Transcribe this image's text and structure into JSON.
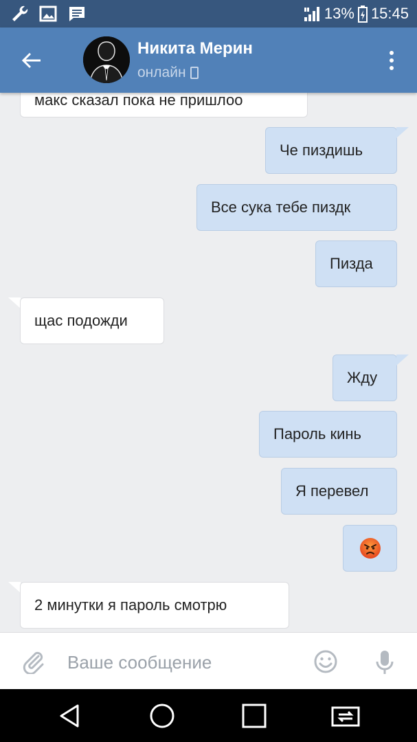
{
  "status_bar": {
    "battery_percent": "13%",
    "time": "15:45",
    "icons": [
      "wrench-icon",
      "image-icon",
      "message-icon",
      "signal-icon",
      "battery-icon"
    ]
  },
  "header": {
    "contact_name": "Никита Мерин",
    "contact_status": "онлайн",
    "icons": [
      "back-arrow-icon",
      "phone-icon",
      "more-vert-icon"
    ]
  },
  "messages": [
    {
      "dir": "in",
      "text": "макс сказал пока не пришлоо"
    },
    {
      "dir": "out",
      "text": "Че пиздишь"
    },
    {
      "dir": "out",
      "text": "Все сука тебе пиздк"
    },
    {
      "dir": "out",
      "text": "Пизда"
    },
    {
      "dir": "in",
      "text": "щас подожди"
    },
    {
      "dir": "out",
      "text": "Жду"
    },
    {
      "dir": "out",
      "text": "Пароль кинь"
    },
    {
      "dir": "out",
      "text": "Я перевел"
    },
    {
      "dir": "out",
      "text": "angry-face-emoji"
    },
    {
      "dir": "in",
      "text": "2 минутки я пароль смотрю"
    }
  ],
  "composer": {
    "placeholder": "Ваше сообщение",
    "value": "",
    "icons": [
      "paperclip-icon",
      "smiley-icon",
      "microphone-icon"
    ]
  },
  "nav_bar": {
    "icons": [
      "back-triangle-icon",
      "home-circle-icon",
      "recents-square-icon",
      "screen-switch-icon"
    ]
  }
}
